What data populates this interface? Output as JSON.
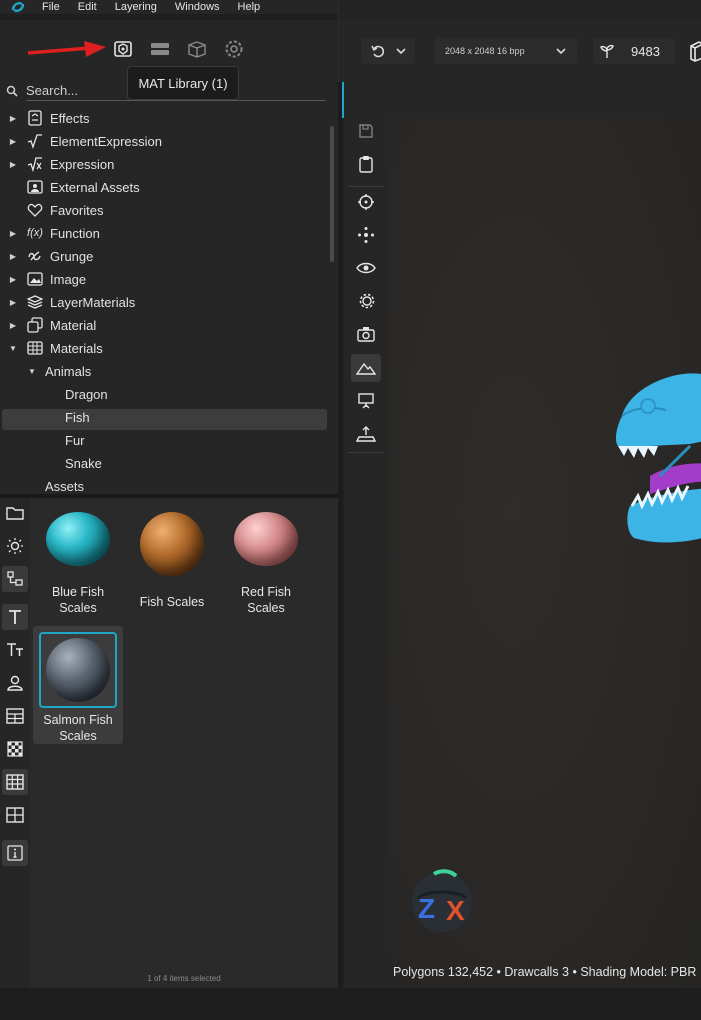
{
  "menu": {
    "items": [
      "File",
      "Edit",
      "Layering",
      "Windows",
      "Help"
    ]
  },
  "tooltip": {
    "text": "MAT Library (1)"
  },
  "toolbar": {
    "icons": [
      "mat-library-icon",
      "layers-icon",
      "package-icon",
      "settings-icon"
    ],
    "resolution": "2048 x 2048 16 bpp",
    "seed_value": "9483"
  },
  "search": {
    "placeholder": "Search..."
  },
  "tree": {
    "items": [
      {
        "label": "Effects",
        "icon": "effects-icon",
        "expandable": true
      },
      {
        "label": "ElementExpression",
        "icon": "sqrt-icon",
        "expandable": true
      },
      {
        "label": "Expression",
        "icon": "sqrt-x-icon",
        "expandable": true
      },
      {
        "label": "External Assets",
        "icon": "external-assets-icon",
        "expandable": false
      },
      {
        "label": "Favorites",
        "icon": "heart-icon",
        "expandable": false
      },
      {
        "label": "Function",
        "icon": "function-icon",
        "expandable": true
      },
      {
        "label": "Grunge",
        "icon": "grunge-icon",
        "expandable": true
      },
      {
        "label": "Image",
        "icon": "image-icon",
        "expandable": true
      },
      {
        "label": "LayerMaterials",
        "icon": "stack-icon",
        "expandable": true
      },
      {
        "label": "Material",
        "icon": "material-icon",
        "expandable": true
      },
      {
        "label": "Materials",
        "icon": "materials-icon",
        "expandable": true,
        "expanded": true
      },
      {
        "label": "Animals",
        "expandable": true,
        "expanded": true
      },
      {
        "label": "Dragon"
      },
      {
        "label": "Fish",
        "selected": true
      },
      {
        "label": "Fur"
      },
      {
        "label": "Snake"
      },
      {
        "label": "Assets"
      }
    ]
  },
  "materials": {
    "items": [
      {
        "name": "Blue Fish Scales",
        "line1": "Blue Fish",
        "line2": "Scales",
        "color": "#2ab8c8"
      },
      {
        "name": "Fish Scales",
        "line1": "Fish Scales",
        "line2": "",
        "color": "#b06a2a"
      },
      {
        "name": "Red Fish Scales",
        "line1": "Red Fish",
        "line2": "Scales",
        "color": "#d48a8a"
      },
      {
        "name": "Salmon Fish Scales",
        "line1": "Salmon Fish",
        "line2": "Scales",
        "color": "#5a6470",
        "selected": true
      }
    ],
    "status": "1 of 4 items selected"
  },
  "viewport": {
    "status": "Polygons 132,452 • Drawcalls 3 • Shading Model: PBR"
  },
  "colors": {
    "accent": "#1fa7c9",
    "arrow": "#e02020",
    "dragon": "#3cb4e6",
    "tongue": "#a33cc8"
  }
}
